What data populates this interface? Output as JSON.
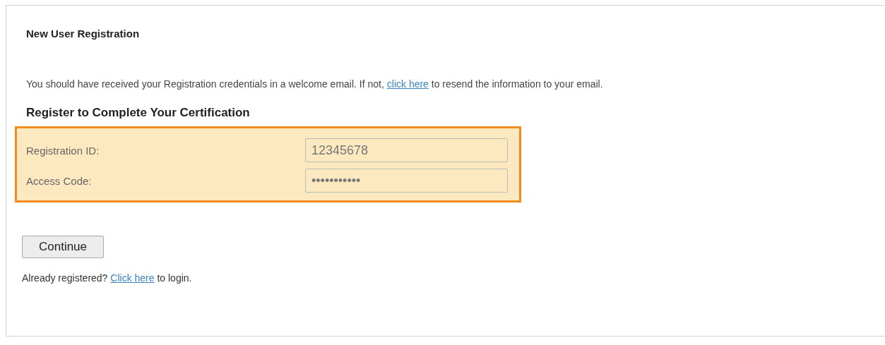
{
  "title": "New User Registration",
  "notice": {
    "before": "You should have received your Registration credentials in a welcome email. If not, ",
    "link": "click here",
    "after": " to resend the information to your email."
  },
  "section_title": "Register to Complete Your Certification",
  "fields": [
    {
      "label": "Registration ID:",
      "value": "12345678"
    },
    {
      "label": "Access Code:",
      "value": "•••••••••••"
    }
  ],
  "button": "Continue",
  "login": {
    "before": "Already registered? ",
    "link": "Click here",
    "after": " to login."
  }
}
